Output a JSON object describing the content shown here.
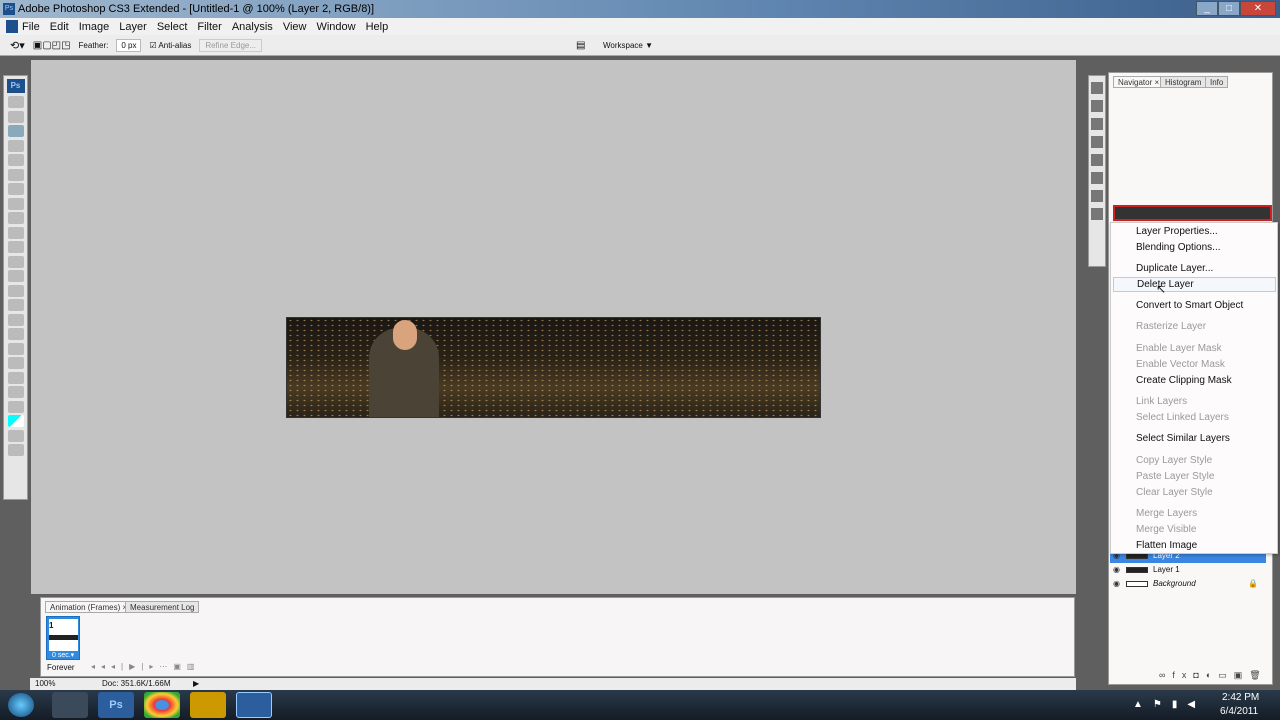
{
  "window": {
    "title": "Adobe Photoshop CS3 Extended - [Untitled-1 @ 100% (Layer 2, RGB/8)]",
    "app_icon": "Ps"
  },
  "menu": [
    "File",
    "Edit",
    "Image",
    "Layer",
    "Select",
    "Filter",
    "Analysis",
    "View",
    "Window",
    "Help"
  ],
  "options": {
    "feather_label": "Feather:",
    "feather_value": "0 px",
    "antialias_label": "Anti-alias",
    "antialias_checked": true,
    "refine_edge": "Refine Edge...",
    "workspace": "Workspace ▼"
  },
  "tools": {
    "logo": "Ps"
  },
  "panels": {
    "tabs": [
      "Navigator ×",
      "Histogram",
      "Info"
    ]
  },
  "context_menu": [
    {
      "label": "Layer Properties...",
      "enabled": true
    },
    {
      "label": "Blending Options...",
      "enabled": true
    },
    {
      "label": "Duplicate Layer...",
      "enabled": true
    },
    {
      "label": "Delete Layer",
      "enabled": true,
      "hovered": true
    },
    {
      "label": "Convert to Smart Object",
      "enabled": true
    },
    {
      "label": "Rasterize Layer",
      "enabled": false
    },
    {
      "label": "Enable Layer Mask",
      "enabled": false
    },
    {
      "label": "Enable Vector Mask",
      "enabled": false
    },
    {
      "label": "Create Clipping Mask",
      "enabled": true
    },
    {
      "label": "Link Layers",
      "enabled": false
    },
    {
      "label": "Select Linked Layers",
      "enabled": false
    },
    {
      "label": "Select Similar Layers",
      "enabled": true
    },
    {
      "label": "Copy Layer Style",
      "enabled": false
    },
    {
      "label": "Paste Layer Style",
      "enabled": false
    },
    {
      "label": "Clear Layer Style",
      "enabled": false
    },
    {
      "label": "Merge Layers",
      "enabled": false
    },
    {
      "label": "Merge Visible",
      "enabled": false
    },
    {
      "label": "Flatten Image",
      "enabled": true
    }
  ],
  "layers": [
    {
      "name": "Layer 2",
      "selected": true
    },
    {
      "name": "Layer 1"
    },
    {
      "name": "Background",
      "locked": true
    }
  ],
  "animation": {
    "tabs": [
      "Animation (Frames) ×",
      "Measurement Log"
    ],
    "frame_number": "1",
    "frame_delay": "0 sec.▾",
    "loop": "Forever"
  },
  "status": {
    "zoom": "100%",
    "doc": "Doc: 351.6K/1.66M"
  },
  "taskbar": {
    "time": "2:42 PM",
    "date": "6/4/2011"
  }
}
